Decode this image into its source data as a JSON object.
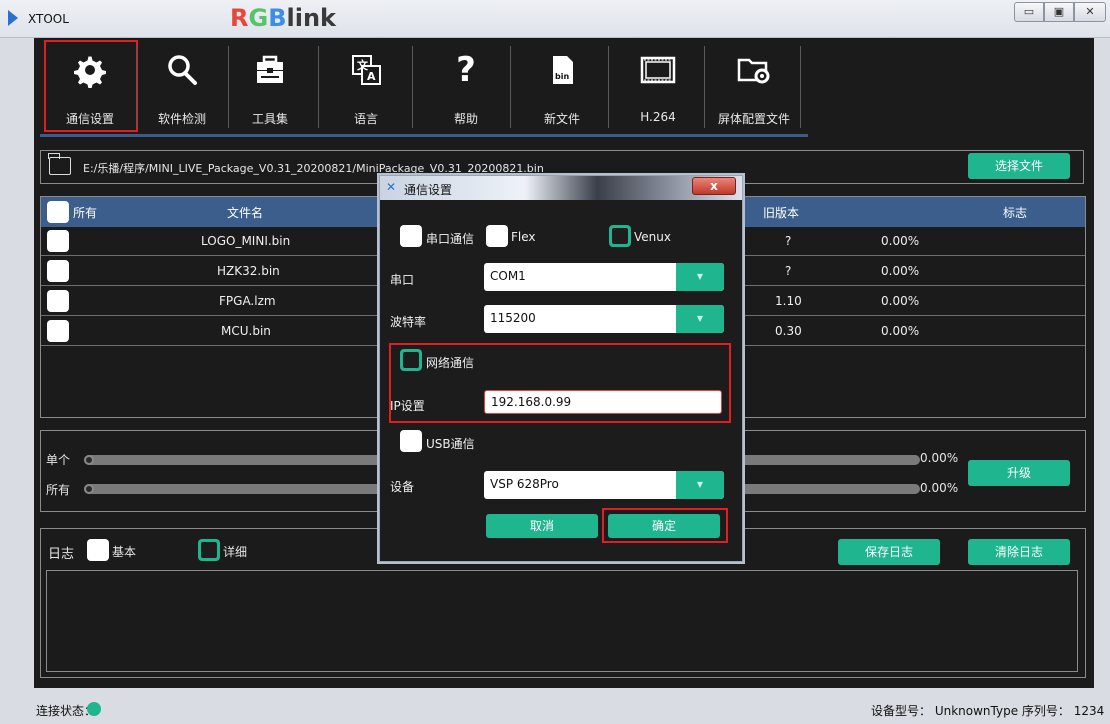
{
  "window": {
    "title": "XTOOL",
    "brand": {
      "r": "R",
      "g": "G",
      "b": "B",
      "link": "link"
    },
    "min_icon": "window-minimize-icon",
    "max_icon": "window-maximize-icon",
    "close_icon": "window-close-icon"
  },
  "toolbar": {
    "items": [
      {
        "label": "通信设置",
        "icon": "gear-icon"
      },
      {
        "label": "软件检测",
        "icon": "magnifier-icon"
      },
      {
        "label": "工具集",
        "icon": "toolbox-icon"
      },
      {
        "label": "语言",
        "icon": "language-icon"
      },
      {
        "label": "帮助",
        "icon": "question-icon"
      },
      {
        "label": "新文件",
        "icon": "bin-file-icon"
      },
      {
        "label": "H.264",
        "icon": "film-icon"
      },
      {
        "label": "屏体配置文件",
        "icon": "folder-gear-icon"
      }
    ],
    "bin_glyph": "bin"
  },
  "file_path": {
    "path": "E:/乐播/程序/MINI_LIVE_Package_V0.31_20200821/MiniPackage_V0.31_20200821.bin",
    "choose_file": "选择文件"
  },
  "table": {
    "headers": {
      "all": "所有",
      "filename": "文件名",
      "old_version": "旧版本",
      "flag": "标志"
    },
    "rows": [
      {
        "filename": "LOGO_MINI.bin",
        "old_version": "?",
        "percent": "0.00%"
      },
      {
        "filename": "HZK32.bin",
        "old_version": "?",
        "percent": "0.00%"
      },
      {
        "filename": "FPGA.lzm",
        "old_version": "1.10",
        "percent": "0.00%"
      },
      {
        "filename": "MCU.bin",
        "old_version": "0.30",
        "percent": "0.00%"
      }
    ]
  },
  "progress": {
    "single_label": "单个",
    "all_label": "所有",
    "single_percent": "0.00%",
    "all_percent": "0.00%",
    "single_value": 0,
    "all_value": 0,
    "upgrade": "升级"
  },
  "log": {
    "label": "日志",
    "basic": "基本",
    "detail": "详细",
    "save": "保存日志",
    "clear": "清除日志"
  },
  "status": {
    "connection_label": "连接状态：",
    "device_info": "设备型号： UnknownType 序列号： 1234",
    "connection_color": "#1fb58f"
  },
  "dialog": {
    "title": "通信设置",
    "close": "x",
    "serial_comm": "串口通信",
    "flex": "Flex",
    "venux": "Venux",
    "serial_port_label": "串口",
    "serial_port_value": "COM1",
    "baud_label": "波特率",
    "baud_value": "115200",
    "network_comm": "网络通信",
    "ip_label": "IP设置",
    "ip_value": "192.168.0.99",
    "usb_comm": "USB通信",
    "device_label": "设备",
    "device_value": "VSP 628Pro",
    "cancel": "取消",
    "ok": "确定",
    "dropdown_arrow": "▼"
  },
  "colors": {
    "accent_green": "#1fb58f",
    "header_blue": "#3b5e8c",
    "highlight_red": "#e02020",
    "panel_bg": "#1b1b1b"
  }
}
